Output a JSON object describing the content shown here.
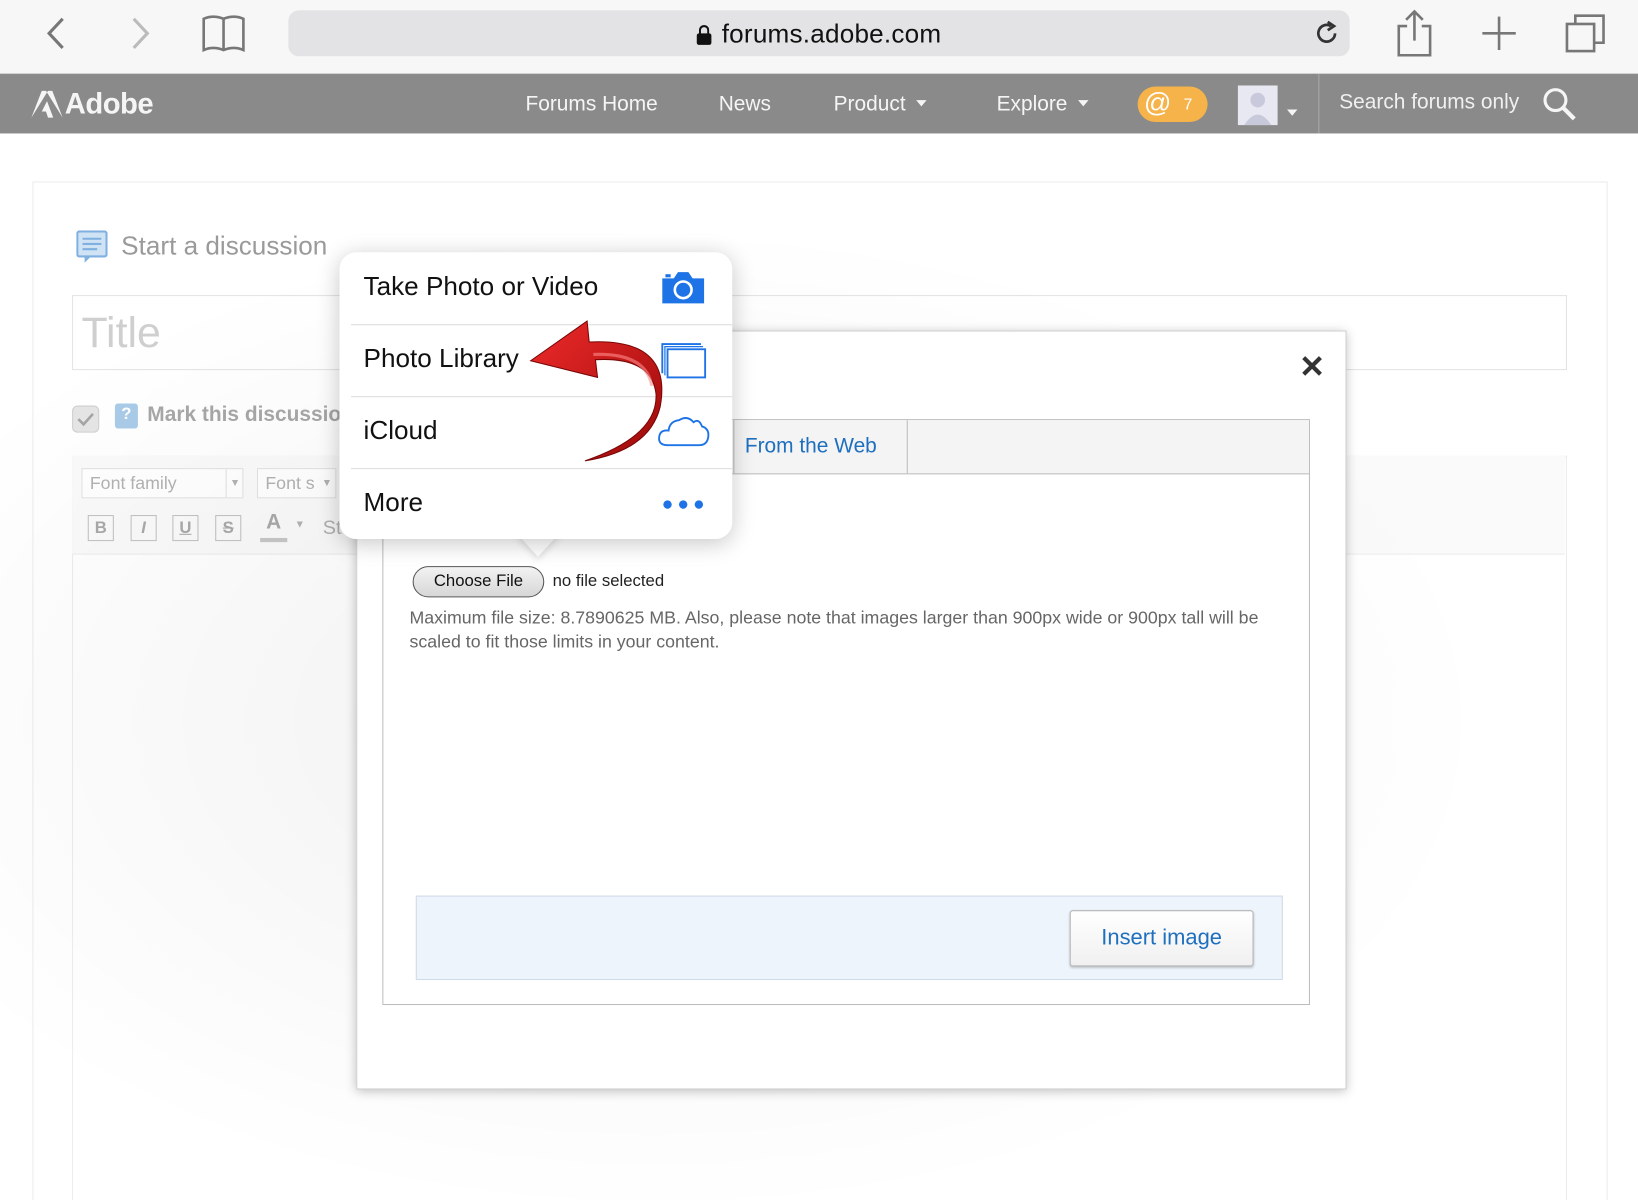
{
  "browser": {
    "url": "forums.adobe.com"
  },
  "nav": {
    "logo": "Adobe",
    "forums_home": "Forums Home",
    "news": "News",
    "product": "Product",
    "explore": "Explore",
    "mentions_count": "7",
    "search_placeholder": "Search forums only"
  },
  "page": {
    "section_title": "Start a discussion",
    "title_placeholder": "Title",
    "mark_question": "Mark this discussion",
    "font_family": "Font family",
    "font_size": "Font s",
    "style_stub": "St"
  },
  "modal": {
    "tab_web": "From the Web",
    "choose_file": "Choose File",
    "no_file": "no file selected",
    "file_note": "Maximum file size: 8.7890625 MB. Also, please note that images larger than 900px wide or 900px tall will be scaled to fit those limits in your content.",
    "insert_image": "Insert image"
  },
  "popover": {
    "items": [
      {
        "label": "Take Photo or Video",
        "icon": "camera-icon"
      },
      {
        "label": "Photo Library",
        "icon": "photo-library-icon"
      },
      {
        "label": "iCloud",
        "icon": "cloud-icon"
      },
      {
        "label": "More",
        "icon": "more-dots-icon"
      }
    ]
  },
  "colors": {
    "ios_blue": "#1e73e6",
    "link_blue": "#1f6fbf",
    "nav_gray": "#8a8a8a",
    "badge_orange": "#f5b34a",
    "annotation_red": "#cc1111"
  }
}
